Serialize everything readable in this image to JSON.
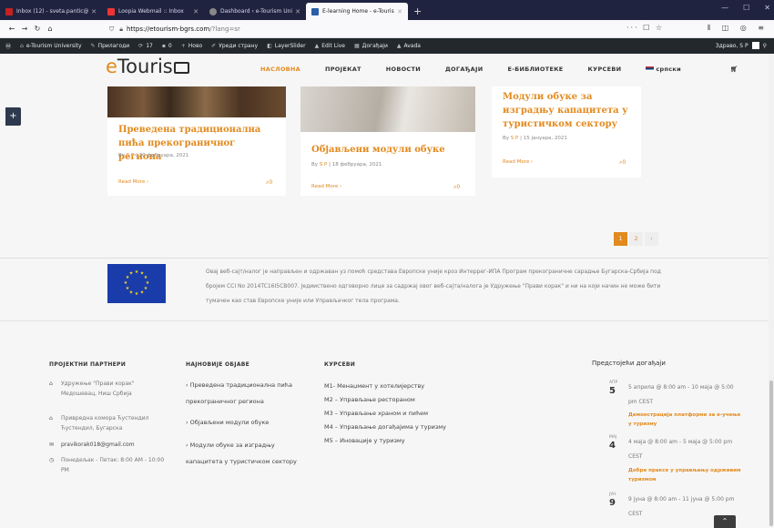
{
  "browser": {
    "tabs": [
      {
        "title": "Inbox (12) - sveta.pantic@gm",
        "fav": "#c5221f"
      },
      {
        "title": "Loopia Webmail :: Inbox",
        "fav": "#e33"
      },
      {
        "title": "Dashboard ‹ e-Tourism Univers",
        "fav": "#888"
      },
      {
        "title": "E-learning Home - e-Tourism U",
        "fav": "#2b5ea7"
      }
    ],
    "new_tab": "+",
    "url_host": "https://etourism-bgrs.com",
    "url_path": "/?lang=sr",
    "url_right": "··· ☐ ☆",
    "nav_right": "⫴ ◫ ◎ ≡"
  },
  "adminbar": {
    "items": [
      "e-Tourism University",
      "Прилагоди",
      "17",
      "0",
      "Ново",
      "Уреди страну",
      "LayerSlider",
      "Edit Live",
      "Догађаји",
      "Avada"
    ],
    "greeting": "Здраво, S P"
  },
  "header": {
    "logo_e": "e",
    "logo_rest": "Touris",
    "menu": [
      "НАСЛОВНА",
      "ПРОЈЕКАТ",
      "НОВОСТИ",
      "ДОГАЂАЈИ",
      "Е-БИБЛИОТЕКЕ",
      "КУРСЕВИ",
      "српски"
    ]
  },
  "posts": [
    {
      "title": "Преведена традиционална пића прекограничног региона",
      "author": "S P",
      "date": "20 фебруара, 2021",
      "more": "Read More ›",
      "comments": "0"
    },
    {
      "title": "Објављени модули обуке",
      "author": "S P",
      "date": "18 фебруара, 2021",
      "more": "Read More ›",
      "comments": "0"
    },
    {
      "title": "Модули обуке за изградњу капацитета у туристичком сектору",
      "author": "S P",
      "date": "15 јануара, 2021",
      "more": "Read More ›",
      "comments": "0"
    }
  ],
  "meta_by": "By",
  "pager": [
    "1",
    "2",
    "›"
  ],
  "eu_notice": "Овај веб-сајт/налог је направљен и одржаван уз помоћ средстава Европске уније кроз Интеррег-ИПА Програм прекограничне сарадње Бугарска-Србија под бројем CCI No 2014TC16I5CB007. Једииствено одговорно лице за садржај овог веб-сајта/налога је Удружење \"Прави корак\" и ни на који начин не може бити тумачен као став Европске уније или Управљачког тела програма.",
  "footer": {
    "partners_title": "ПРОЈЕКТНИ ПАРТНЕРИ",
    "partners": [
      "Удружење \"Прави корак\" Медошевац, Ниш Србија",
      "Привредна комора Ћустендил Ћустендил, Бугарска"
    ],
    "email": "pravikorak018@gmail.com",
    "hours": "Понедељак - Петак: 8:00 AM - 10:00 PM",
    "posts_title": "НАЈНОВИЈЕ ОБЈАВЕ",
    "recent": [
      "› Преведена традиционална пића прекограничног региона",
      "› Објављени модули обуке",
      "› Модули обуке за изградњу капацитета у туристичком сектору"
    ],
    "courses_title": "КУРСЕВИ",
    "courses": [
      "M1- Менаџмент у хотелијерству",
      "M2 – Управљање ресторaном",
      "M3 – Управљање храном и пићем",
      "M4 – Управљање догађајима у туризму",
      "M5 – Иновације у туризму"
    ],
    "events_title": "Предстојећи догађаји",
    "events": [
      {
        "month": "АПР",
        "day": "5",
        "time": "5 априла @ 8:00 am - 10 маја @ 5:00 pm CEST",
        "name": "Демонстрација платформе за e-учење у туризму"
      },
      {
        "month": "МАЈ",
        "day": "4",
        "time": "4 маја @ 8:00 am - 5 маја @ 5:00 pm CEST",
        "name": "Добре праксе у управљању одрживим туризмом"
      },
      {
        "month": "ЈУН",
        "day": "9",
        "time": "9 јуна @ 8:00 am - 11 јуна @ 5:00 pm CEST",
        "name": ""
      }
    ]
  }
}
